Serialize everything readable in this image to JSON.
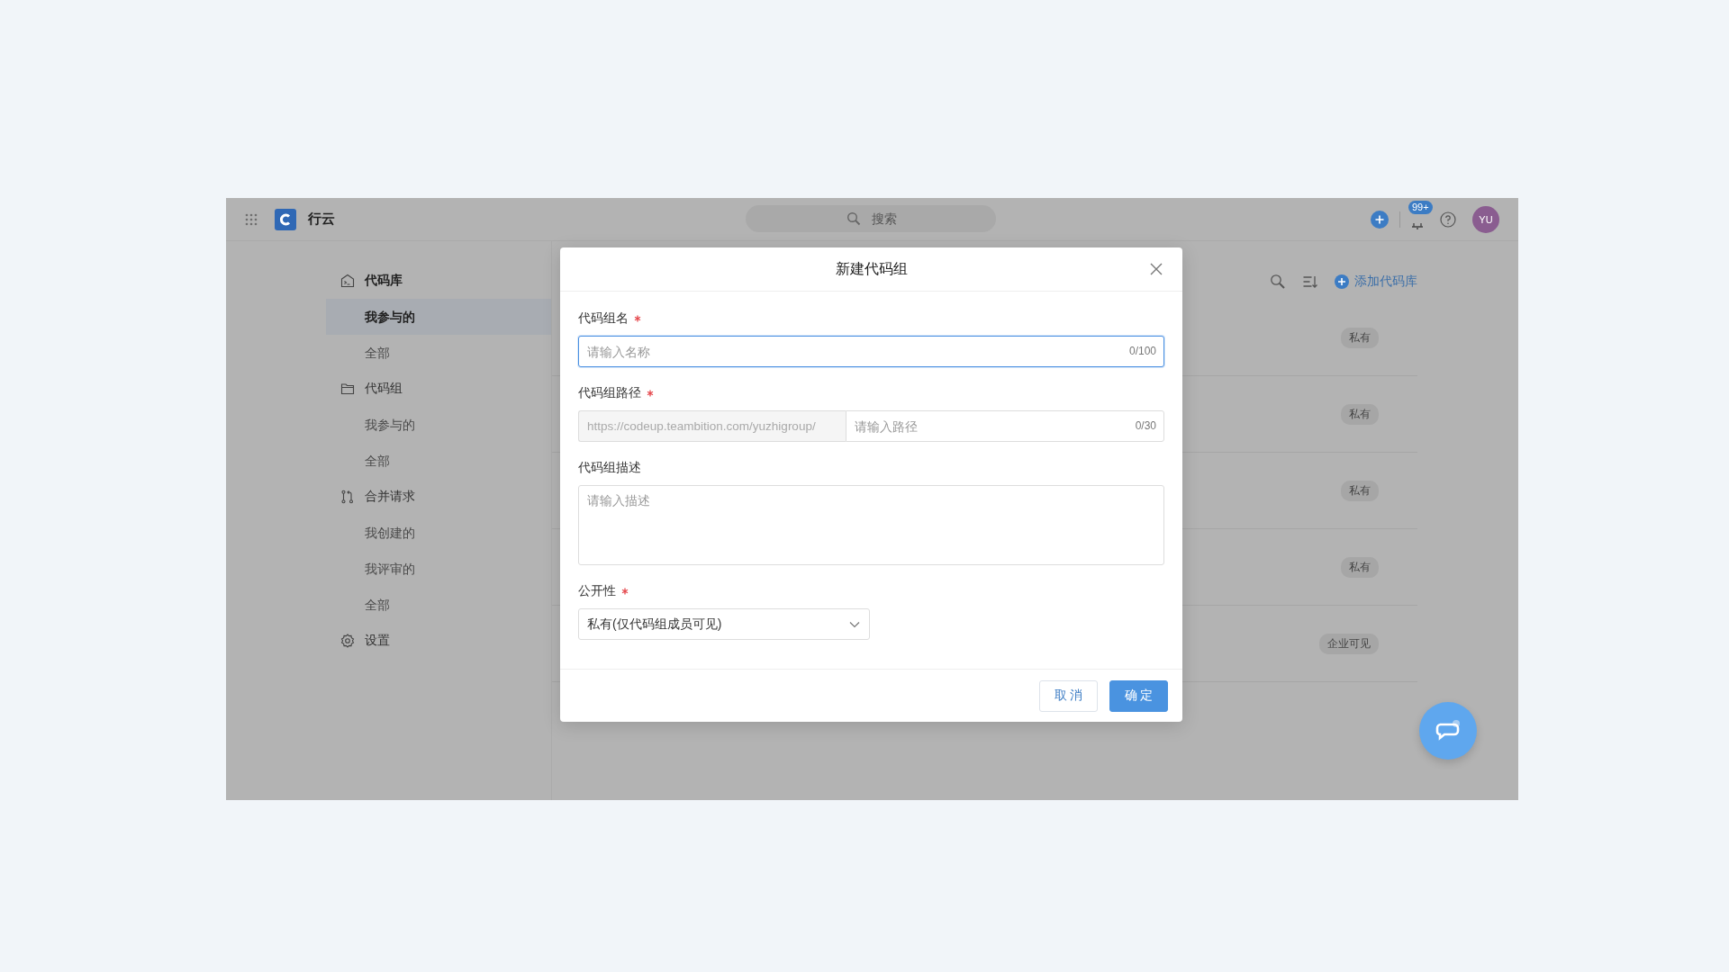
{
  "topbar": {
    "app_name": "行云",
    "search": {
      "placeholder": "搜索"
    },
    "notification_badge": "99+",
    "avatar": "YU"
  },
  "sidebar": {
    "sections": [
      {
        "kind": "repo",
        "label": "代码库",
        "children": [
          {
            "label": "我参与的",
            "selected": true
          },
          {
            "label": "全部",
            "selected": false
          }
        ]
      },
      {
        "kind": "group",
        "label": "代码组",
        "children": [
          {
            "label": "我参与的",
            "selected": false
          },
          {
            "label": "全部",
            "selected": false
          }
        ]
      },
      {
        "kind": "merge",
        "label": "合并请求",
        "children": [
          {
            "label": "我创建的",
            "selected": false
          },
          {
            "label": "我评审的",
            "selected": false
          },
          {
            "label": "全部",
            "selected": false
          }
        ]
      },
      {
        "kind": "settings",
        "label": "设置"
      }
    ]
  },
  "toolbar": {
    "add_button": "添加代码库"
  },
  "repo_rows": [
    {
      "visibility": "私有"
    },
    {
      "visibility": "私有"
    },
    {
      "visibility": "私有"
    },
    {
      "visibility": "私有"
    },
    {
      "visibility": "企业可见"
    }
  ],
  "dialog": {
    "title": "新建代码组",
    "fields": [
      {
        "kind": "text",
        "label": "代码组名",
        "required": true,
        "focused": true,
        "placeholder": "请输入名称",
        "counter": "0/100"
      },
      {
        "kind": "path",
        "label": "代码组路径",
        "required": true,
        "focused": false,
        "prefix": "https://codeup.teambition.com/yuzhigroup/",
        "placeholder": "请输入路径",
        "counter": "0/30"
      },
      {
        "kind": "textarea",
        "label": "代码组描述",
        "required": false,
        "focused": false,
        "placeholder": "请输入描述"
      },
      {
        "kind": "select",
        "label": "公开性",
        "required": true,
        "focused": false,
        "value": "私有(仅代码组成员可见)"
      }
    ],
    "buttons": [
      {
        "kind": "secondary",
        "label": "取 消"
      },
      {
        "kind": "primary",
        "label": "确 定"
      }
    ]
  }
}
